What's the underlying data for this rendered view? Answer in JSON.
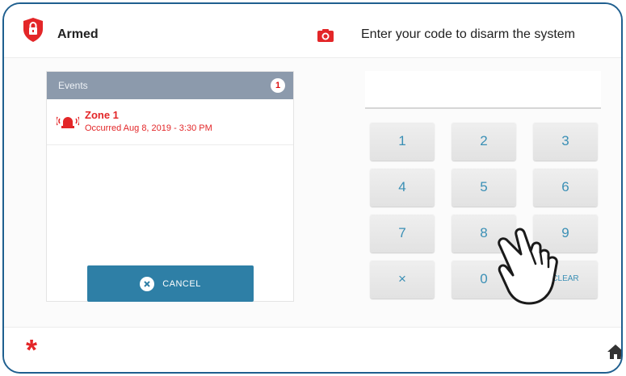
{
  "status": {
    "label": "Armed",
    "icon": "lock-shield-icon",
    "color": "#e32628"
  },
  "prompt": {
    "icon": "camera-icon",
    "text": "Enter your code to disarm the system"
  },
  "events": {
    "title": "Events",
    "count": "1",
    "items": [
      {
        "icon": "siren-icon",
        "zone": "Zone 1",
        "time": "Occurred Aug 8, 2019 - 3:30 PM"
      }
    ],
    "cancel_label": "CANCEL"
  },
  "keypad": {
    "keys": [
      "1",
      "2",
      "3",
      "4",
      "5",
      "6",
      "7",
      "8",
      "9",
      "×",
      "0",
      "CLEAR"
    ],
    "accent": "#3a8fb5"
  },
  "bottom": {
    "left_icon": "asterisk-icon",
    "left_symbol": "*",
    "right_icon": "home-icon"
  },
  "overlay": {
    "icon": "hand-pointer-icon"
  }
}
